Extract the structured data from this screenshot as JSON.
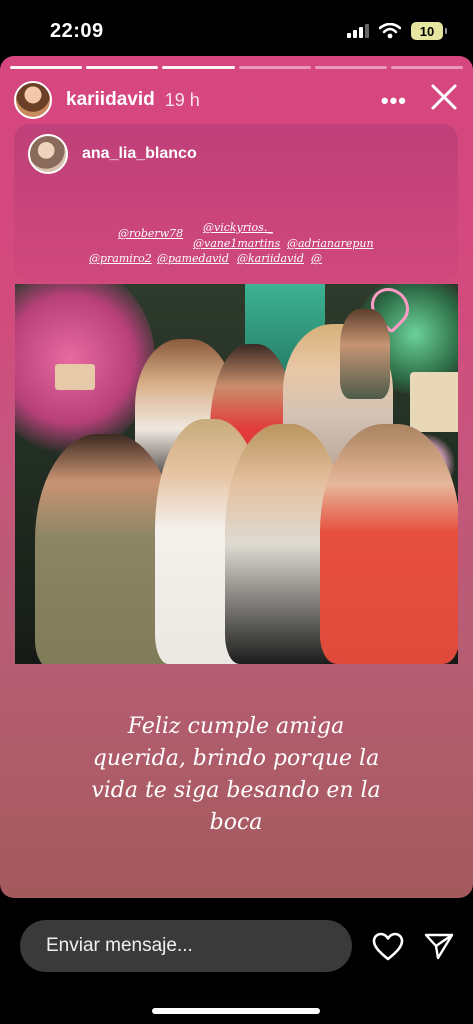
{
  "status_bar": {
    "time": "22:09",
    "battery": "10",
    "icons": [
      "signal-icon",
      "wifi-icon",
      "battery-icon"
    ]
  },
  "story": {
    "progress": {
      "segments": 6,
      "current": 3
    },
    "author": "kariidavid",
    "time": "19 h",
    "more_icon": "more-icon",
    "close_icon": "close-icon"
  },
  "repost": {
    "author": "ana_lia_blanco",
    "mentions": [
      "@roberw78",
      "@vickyrios._",
      "@vane1martins",
      "@adrianarepun",
      "@pramiro2",
      "@pamedavid",
      "@kariidavid",
      "@"
    ],
    "caption_lines": [
      "Feliz cumple amiga",
      "querida, brindo porque la",
      "vida te siga besando en la",
      "boca"
    ]
  },
  "photo": {
    "alt": "group-photo"
  },
  "reply": {
    "placeholder": "Enviar mensaje...",
    "heart_icon": "heart-icon",
    "send_icon": "send-icon"
  },
  "colors": {
    "story_top": "#d6467f",
    "story_bottom": "#a35a5c",
    "input_bg": "#3a3a3a"
  }
}
